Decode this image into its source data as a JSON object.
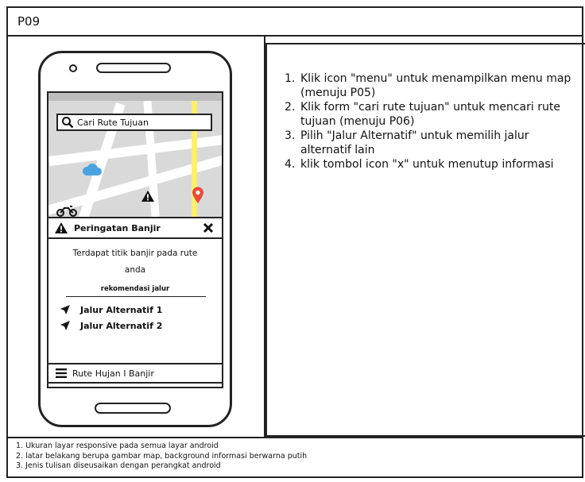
{
  "header": {
    "page_code": "P09"
  },
  "phone": {
    "search": {
      "placeholder": "Cari Rute Tujuan"
    },
    "info_card": {
      "title": "Peringatan Banjir",
      "description": "Terdapat titik banjir pada rute anda",
      "recommendation_label": "rekomendasi jalur",
      "routes": [
        "Jalur Alternatif 1",
        "Jalur Alternatif 2"
      ]
    },
    "bottom_bar": {
      "label": "Rute Hujan I Banjir"
    },
    "colors": {
      "map_bg": "#d9d9d9",
      "yellow_road": "#fff06a",
      "pin": "#e84a3a",
      "cloud": "#4aa3df"
    }
  },
  "instructions": [
    {
      "num": "1.",
      "text": "Klik icon \"menu\" untuk  menampilkan menu map (menuju P05)"
    },
    {
      "num": "2.",
      "text": "Klik form \"cari rute tujuan\" untuk mencari rute tujuan (menuju P06)"
    },
    {
      "num": "3.",
      "text": "Pilih \"Jalur Alternatif\" untuk memilih jalur alternatif lain"
    },
    {
      "num": "4.",
      "text": "klik tombol icon \"x\" untuk menutup informasi"
    }
  ],
  "notes": [
    "1. Ukuran layar responsive pada semua layar android",
    "2. latar belakang berupa gambar map, background informasi berwarna putih",
    "3. Jenis tulisan diseusaikan dengan perangkat android"
  ]
}
